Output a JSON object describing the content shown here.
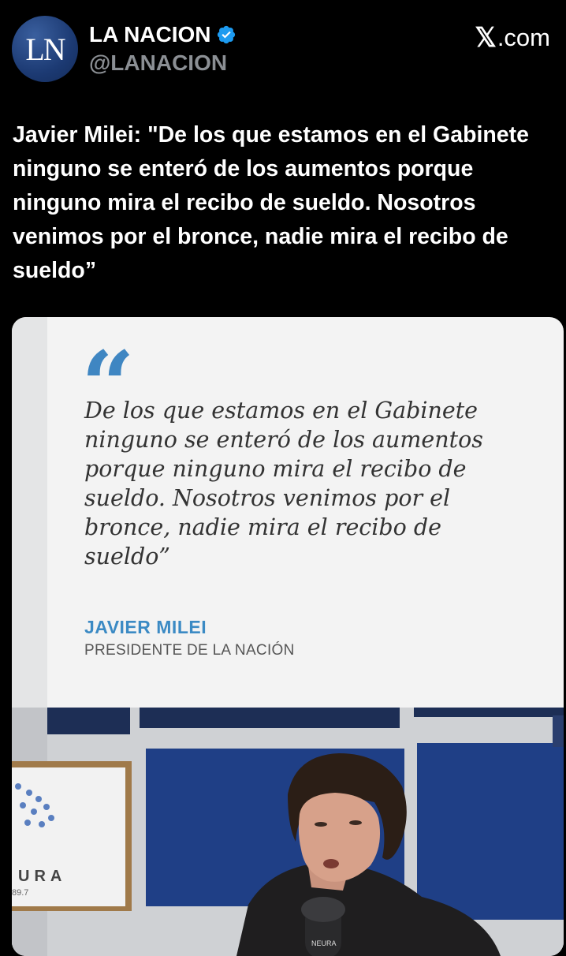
{
  "account": {
    "avatar_text": "LN",
    "name": "LA NACION",
    "handle": "@LANACION",
    "verified": true
  },
  "site": {
    "mark": "𝕏",
    "domain": ".com"
  },
  "tweet": {
    "text": "Javier Milei: \"De los que estamos en el Gabinete ninguno se enteró de los aumentos porque ninguno mira el recibo de sueldo. Nosotros venimos por el bronce, nadie mira el recibo de sueldo”"
  },
  "card": {
    "quote_symbol": "“",
    "quote": "De los que estamos en el Gabinete ninguno se enteró de los aumentos porque ninguno mira el recibo de sueldo. Nosotros venimos por el bronce, nadie mira el recibo de sueldo”",
    "author": "JAVIER MILEI",
    "role": "PRESIDENTE DE LA NACIÓN"
  },
  "photo": {
    "logo_text": "URA",
    "logo_sub": "89.7",
    "mic_text": "NEURA"
  },
  "colors": {
    "accent": "#3b8ac4",
    "quote_mark": "#3f86c2",
    "avatar": "#1c3a73",
    "verified": "#1d9bf0"
  },
  "icons": [
    "verified-badge-icon",
    "x-logo-icon",
    "quote-icon"
  ]
}
